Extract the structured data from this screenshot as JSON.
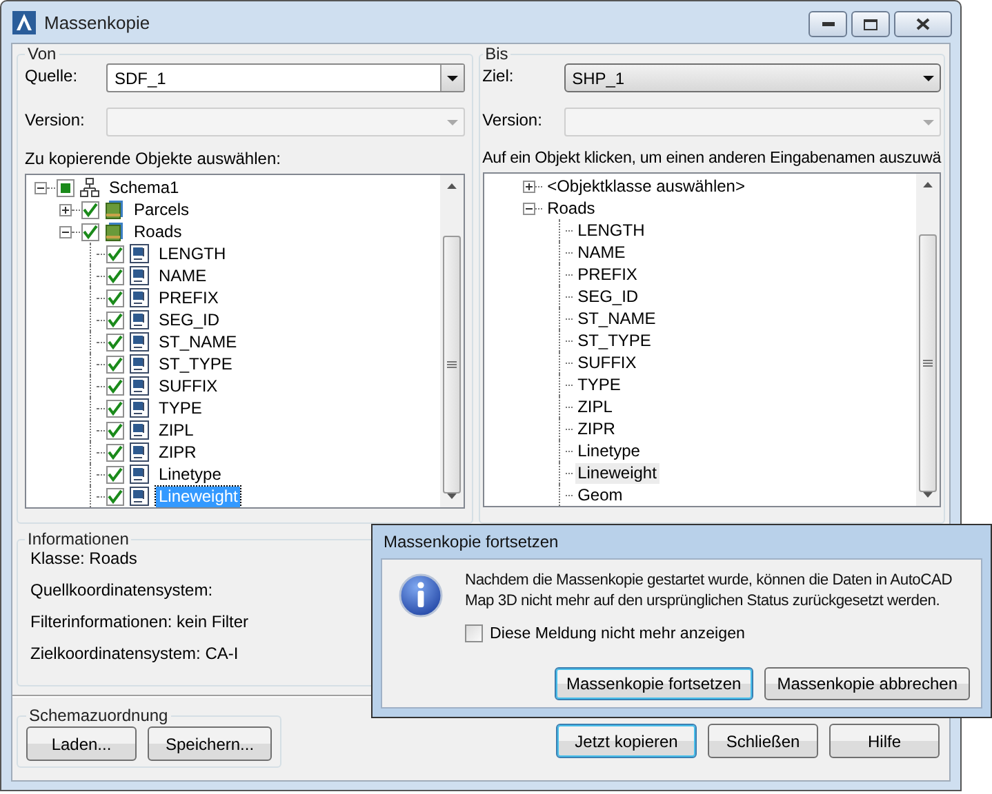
{
  "window": {
    "title": "Massenkopie"
  },
  "source": {
    "title": "Von",
    "source_label": "Quelle:",
    "source_value": "SDF_1",
    "version_label": "Version:",
    "version_disabled": true,
    "tree_label": "Zu kopierende Objekte auswählen:",
    "tree": [
      {
        "label": "Schema1",
        "kind": "schema",
        "checked": true,
        "expanded": true,
        "selected": false,
        "children": [
          {
            "label": "Parcels",
            "kind": "class",
            "checked": true,
            "expanded": false,
            "selected": false
          },
          {
            "label": "Roads",
            "kind": "class",
            "checked": true,
            "expanded": true,
            "selected": false,
            "children": [
              {
                "label": "LENGTH",
                "kind": "field",
                "checked": true,
                "selected": false
              },
              {
                "label": "NAME",
                "kind": "field",
                "checked": true,
                "selected": false
              },
              {
                "label": "PREFIX",
                "kind": "field",
                "checked": true,
                "selected": false
              },
              {
                "label": "SEG_ID",
                "kind": "field",
                "checked": true,
                "selected": false
              },
              {
                "label": "ST_NAME",
                "kind": "field",
                "checked": true,
                "selected": false
              },
              {
                "label": "ST_TYPE",
                "kind": "field",
                "checked": true,
                "selected": false
              },
              {
                "label": "SUFFIX",
                "kind": "field",
                "checked": true,
                "selected": false
              },
              {
                "label": "TYPE",
                "kind": "field",
                "checked": true,
                "selected": false
              },
              {
                "label": "ZIPL",
                "kind": "field",
                "checked": true,
                "selected": false
              },
              {
                "label": "ZIPR",
                "kind": "field",
                "checked": true,
                "selected": false
              },
              {
                "label": "Linetype",
                "kind": "field",
                "checked": true,
                "selected": false
              },
              {
                "label": "Lineweight",
                "kind": "field",
                "checked": true,
                "selected": true
              }
            ]
          }
        ]
      }
    ]
  },
  "target": {
    "title": "Bis",
    "target_label": "Ziel:",
    "target_value": "SHP_1",
    "version_label": "Version:",
    "version_disabled": true,
    "tree_label": "Auf ein Objekt klicken, um einen anderen Eingabenamen auszuwä",
    "tree": [
      {
        "label": "<Objektklasse auswählen>",
        "expanded": false,
        "selected": false
      },
      {
        "label": "Roads",
        "expanded": true,
        "selected": false,
        "children": [
          {
            "label": "LENGTH",
            "selected": false
          },
          {
            "label": "NAME",
            "selected": false
          },
          {
            "label": "PREFIX",
            "selected": false
          },
          {
            "label": "SEG_ID",
            "selected": false
          },
          {
            "label": "ST_NAME",
            "selected": false
          },
          {
            "label": "ST_TYPE",
            "selected": false
          },
          {
            "label": "SUFFIX",
            "selected": false
          },
          {
            "label": "TYPE",
            "selected": false
          },
          {
            "label": "ZIPL",
            "selected": false
          },
          {
            "label": "ZIPR",
            "selected": false
          },
          {
            "label": "Linetype",
            "selected": false
          },
          {
            "label": "Lineweight",
            "selected": true
          },
          {
            "label": "Geom",
            "selected": false
          }
        ]
      }
    ]
  },
  "information": {
    "title": "Informationen",
    "lines": [
      "Klasse: Roads",
      "Quellkoordinatensystem:",
      "Filterinformationen: kein Filter",
      "Zielkoordinatensystem: CA-I"
    ]
  },
  "schema_mapping": {
    "title": "Schemazuordnung",
    "buttons": [
      "Laden...",
      "Speichern..."
    ]
  },
  "buttons": [
    {
      "label": "Jetzt kopieren",
      "default": true
    },
    {
      "label": "Schließen",
      "default": false
    },
    {
      "label": "Hilfe",
      "default": false
    }
  ],
  "dialog": {
    "title": "Massenkopie fortsetzen",
    "message": "Nachdem die Massenkopie gestartet wurde, können die Daten in AutoCAD Map 3D nicht mehr auf den ursprünglichen Status zurückgesetzt werden.",
    "checkbox": {
      "label": "Diese Meldung nicht mehr anzeigen",
      "checked": false
    },
    "buttons": [
      {
        "label": "Massenkopie fortsetzen",
        "default": true
      },
      {
        "label": "Massenkopie abbrechen",
        "default": false
      }
    ]
  }
}
